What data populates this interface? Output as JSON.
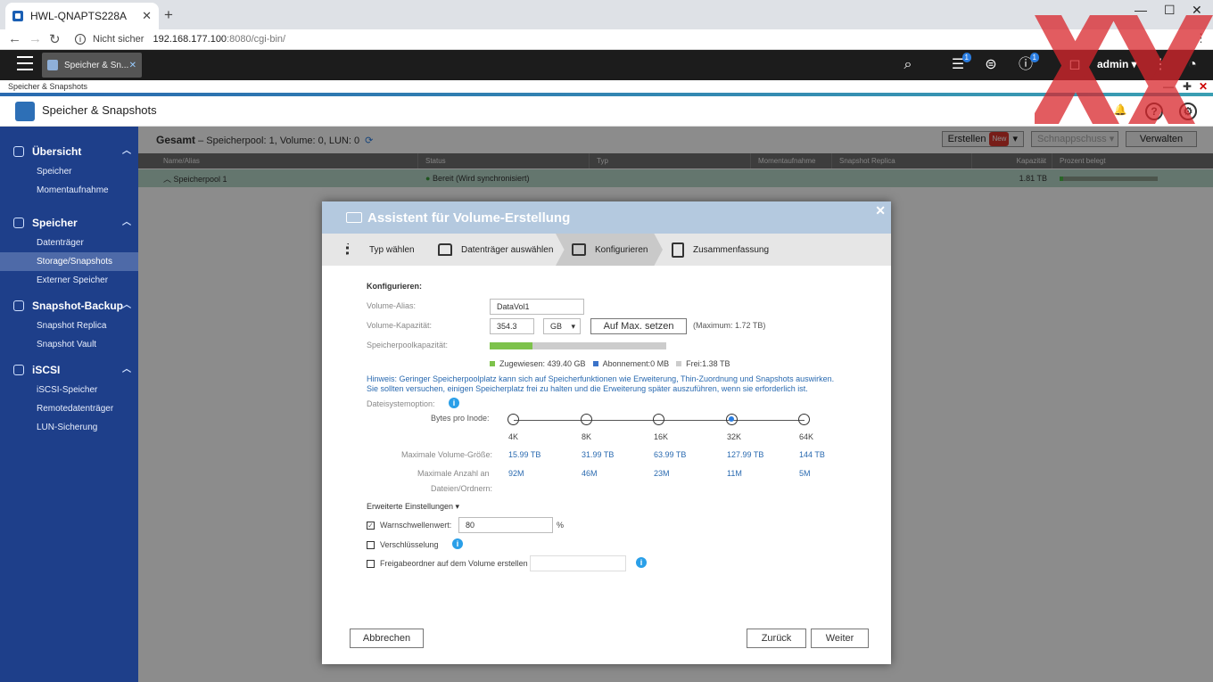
{
  "browser": {
    "tab_title": "HWL-QNAPTS228A",
    "address_prefix": "Nicht sicher",
    "url_host": "192.168.177.100",
    "url_rest": ":8080/cgi-bin/"
  },
  "topbar": {
    "app_tab": "Speicher & Sn...",
    "user": "admin",
    "badge_tasks": "1",
    "badge_info": "1"
  },
  "title_bar": "Speicher & Snapshots",
  "app": {
    "name": "Speicher & Snapshots"
  },
  "sidebar": {
    "sections": [
      {
        "label": "Übersicht",
        "items": [
          "Speicher",
          "Momentaufnahme"
        ]
      },
      {
        "label": "Speicher",
        "items": [
          "Datenträger",
          "Storage/Snapshots",
          "Externer Speicher"
        ]
      },
      {
        "label": "Snapshot-Backup",
        "items": [
          "Snapshot Replica",
          "Snapshot Vault"
        ]
      },
      {
        "label": "iSCSI",
        "items": [
          "iSCSI-Speicher",
          "Remotedatenträger",
          "LUN-Sicherung"
        ]
      }
    ],
    "active": "Storage/Snapshots"
  },
  "summary": {
    "title": "Gesamt",
    "text": "–  Speicherpool: 1, Volume: 0, LUN: 0"
  },
  "toolbar": {
    "create": "Erstellen",
    "new_badge": "New",
    "snapshot": "Schnappschuss",
    "manage": "Verwalten"
  },
  "grid": {
    "headers": [
      "Name/Alias",
      "Status",
      "Typ",
      "Momentaufnahme",
      "Snapshot Replica",
      "Kapazität",
      "Prozent belegt"
    ],
    "row": {
      "name": "Speicherpool 1",
      "status": "Bereit (Wird synchronisiert)",
      "capacity": "1.81 TB",
      "used_fraction": 0.04
    }
  },
  "wizard": {
    "title": "Assistent für Volume-Erstellung",
    "steps": [
      "Typ wählen",
      "Datenträger auswählen",
      "Konfigurieren",
      "Zusammenfassung"
    ],
    "active_step": "Konfigurieren",
    "section": "Konfigurieren:",
    "alias_label": "Volume-Alias:",
    "alias_value": "DataVol1",
    "capacity_label": "Volume-Kapazität:",
    "capacity_value": "354.3",
    "unit": "GB",
    "max_button": "Auf Max. setzen",
    "max_text": "(Maximum: 1.72 TB)",
    "pool_label": "Speicherpoolkapazität:",
    "pool_allocated_fraction": 0.24,
    "legend": {
      "allocated": "Zugewiesen: 439.40 GB",
      "subscribed": "Abonnement:0 MB",
      "free": "Frei:1.38 TB"
    },
    "hint": "Hinweis: Geringer Speicherpoolplatz kann sich auf Speicherfunktionen wie Erweiterung, Thin-Zuordnung und Snapshots auswirken. Sie sollten versuchen, einigen Speicherplatz frei zu halten und die Erweiterung später auszuführen, wenn sie erforderlich ist.",
    "fs_label": "Dateisystemoption:",
    "bpi_label": "Bytes pro Inode:",
    "inode_options": [
      "4K",
      "8K",
      "16K",
      "32K",
      "64K"
    ],
    "inode_selected": "32K",
    "max_size_label": "Maximale Volume-Größe:",
    "max_sizes": [
      "15.99 TB",
      "31.99 TB",
      "63.99 TB",
      "127.99 TB",
      "144 TB"
    ],
    "max_files_label1": "Maximale Anzahl an",
    "max_files_label2": "Dateien/Ordnern:",
    "max_files": [
      "92M",
      "46M",
      "23M",
      "11M",
      "5M"
    ],
    "advanced": "Erweiterte Einstellungen ▾",
    "warn_label": "Warnschwellenwert:",
    "warn_value": "80",
    "warn_unit": "%",
    "encrypt_label": "Verschlüsselung",
    "share_label": "Freigabeordner auf dem Volume erstellen",
    "cancel": "Abbrechen",
    "back": "Zurück",
    "next": "Weiter"
  }
}
